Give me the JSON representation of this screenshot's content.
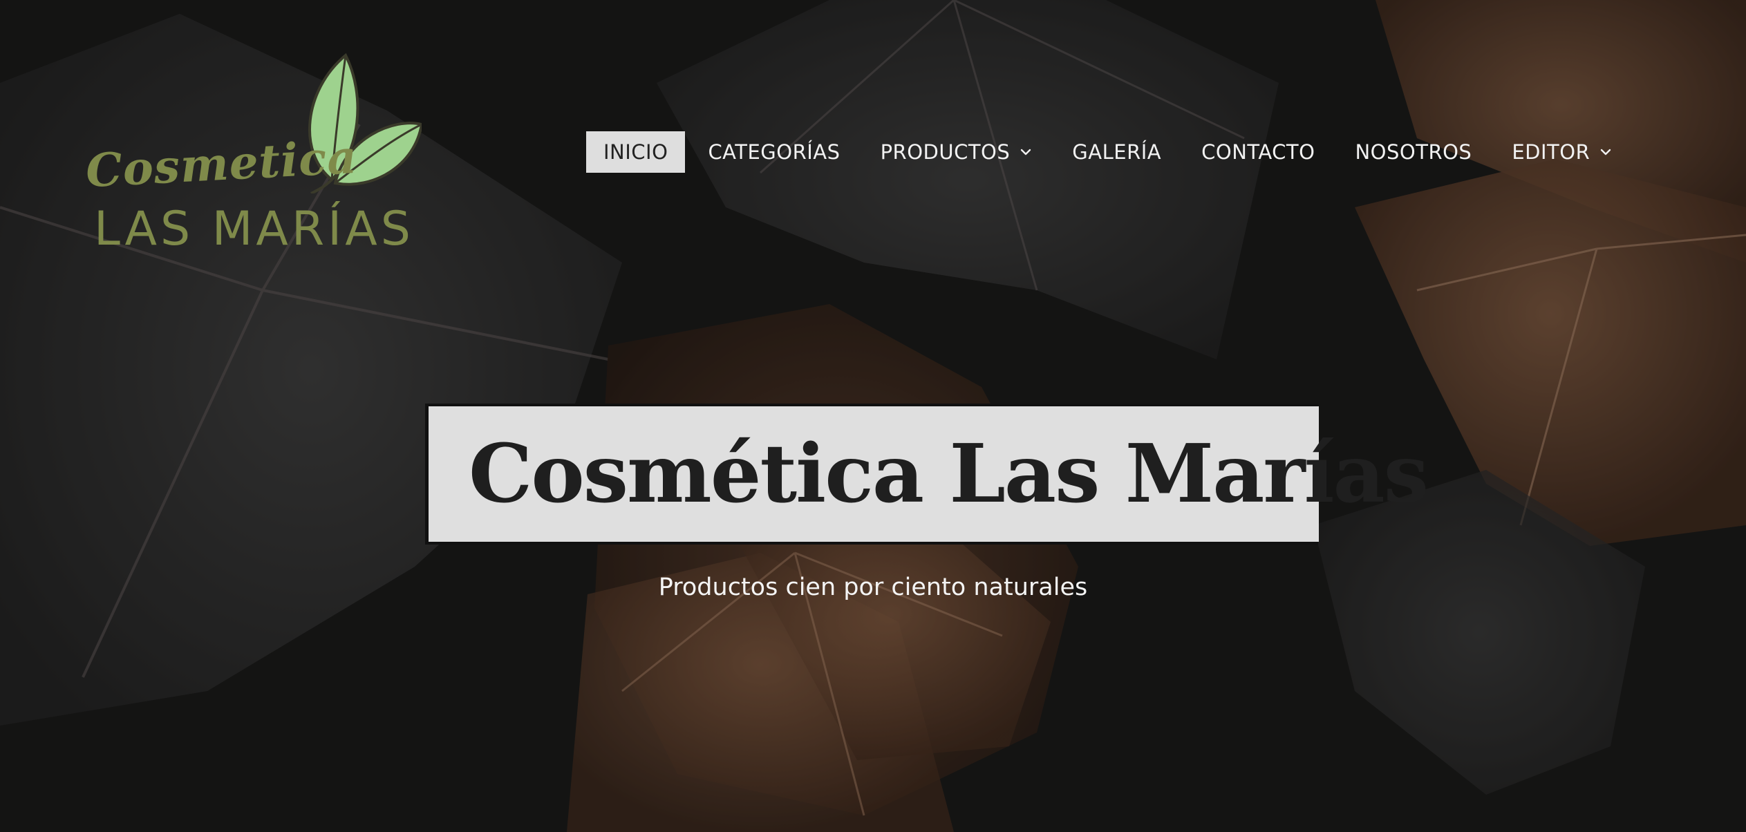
{
  "site": {
    "logo": {
      "script_text": "Cosmetica",
      "caps_text": "LAS MARÍAS",
      "color": "#7f8a4a",
      "leaf_color": "#9ed28e"
    }
  },
  "nav": {
    "items": [
      {
        "label": "INICIO",
        "active": true,
        "has_dropdown": false
      },
      {
        "label": "CATEGORÍAS",
        "active": false,
        "has_dropdown": false
      },
      {
        "label": "PRODUCTOS",
        "active": false,
        "has_dropdown": true,
        "icon": "chevron-down-icon"
      },
      {
        "label": "GALERÍA",
        "active": false,
        "has_dropdown": false
      },
      {
        "label": "CONTACTO",
        "active": false,
        "has_dropdown": false
      },
      {
        "label": "NOSOTROS",
        "active": false,
        "has_dropdown": false
      },
      {
        "label": "EDITOR",
        "active": false,
        "has_dropdown": true,
        "icon": "chevron-down-icon"
      }
    ],
    "active_bg": "#dedede",
    "text_color": "#f2f2f2"
  },
  "hero": {
    "title": "Cosmética Las Marías",
    "subtitle": "Productos cien por ciento naturales",
    "title_bg": "#dfdfdf",
    "title_color": "#1f1f1f",
    "background": "dark-leaves-photo"
  }
}
